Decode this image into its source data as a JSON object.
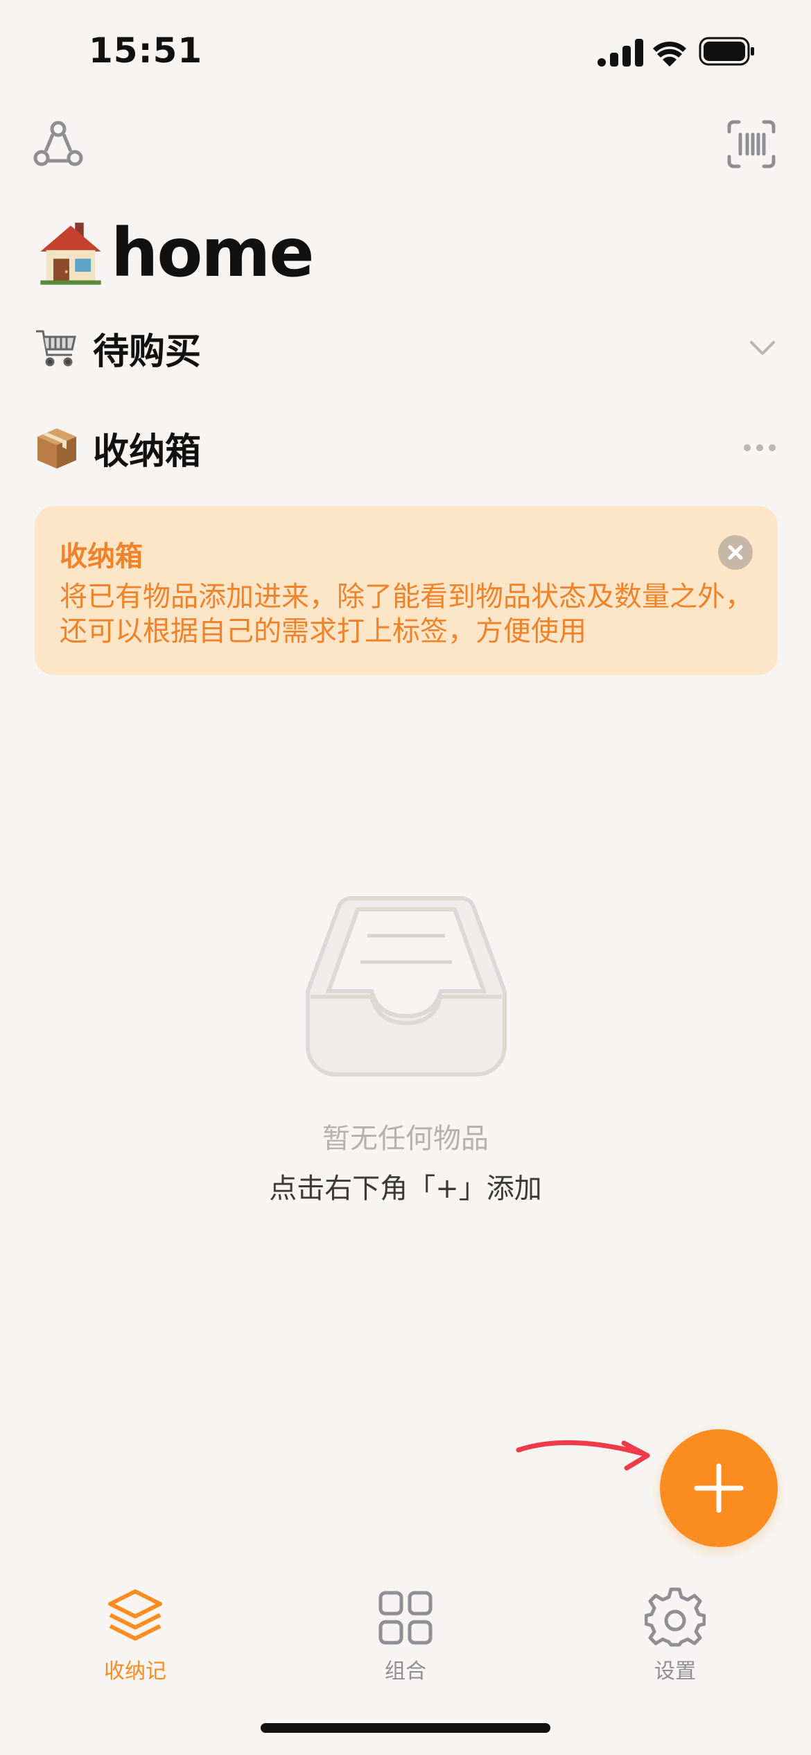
{
  "status_bar": {
    "time": "15:51"
  },
  "header": {
    "title_emoji": "🏠",
    "title": "home"
  },
  "sections": {
    "shopping": {
      "emoji": "🛒",
      "label": "待购买"
    },
    "storage": {
      "emoji": "📦",
      "label": "收纳箱"
    }
  },
  "info_card": {
    "title": "收纳箱",
    "body": "将已有物品添加进来，除了能看到物品状态及数量之外，还可以根据自己的需求打上标签，方便使用"
  },
  "empty_state": {
    "title": "暂无任何物品",
    "hint": "点击右下角「+」添加"
  },
  "tabs": [
    {
      "label": "收纳记",
      "icon": "stack-icon",
      "active": true
    },
    {
      "label": "组合",
      "icon": "grid-icon",
      "active": false
    },
    {
      "label": "设置",
      "icon": "gear-icon",
      "active": false
    }
  ],
  "colors": {
    "accent": "#fb8c1f",
    "card_bg": "#fde6c8",
    "card_text": "#f0832a",
    "background": "#f7f5f3",
    "inactive_tab": "#8e8e93",
    "annotation_arrow": "#ef3b47"
  }
}
